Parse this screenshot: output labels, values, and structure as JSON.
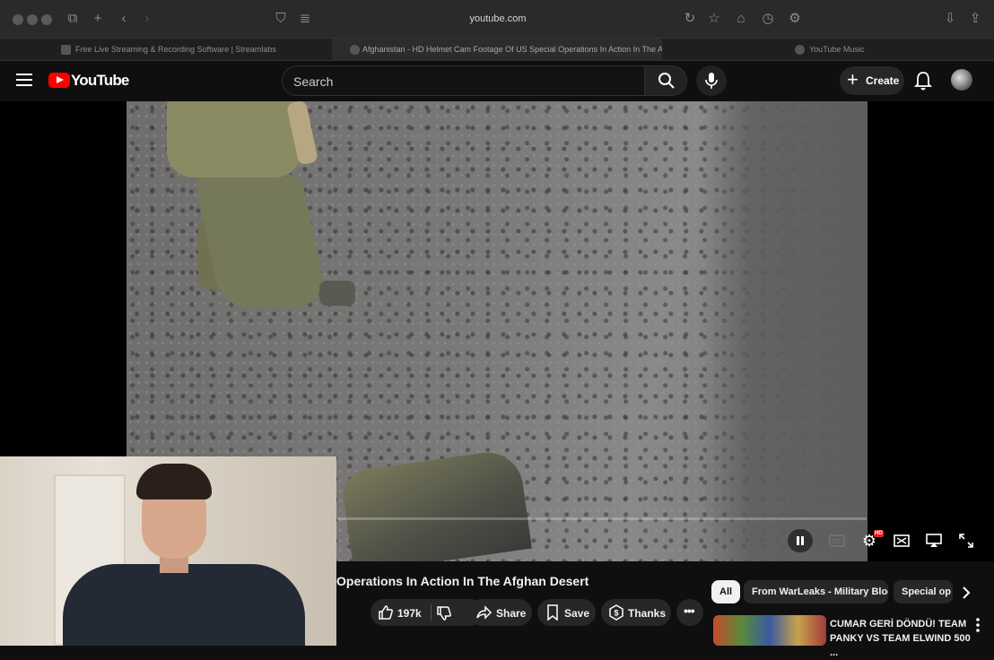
{
  "browser": {
    "url": "youtube.com",
    "tabs": [
      {
        "title": "Free Live Streaming & Recording Software | Streamlabs",
        "active": false
      },
      {
        "title": "Afghanistan - HD Helmet Cam Footage Of US Special Operations In Action In The Af...",
        "active": true
      },
      {
        "title": "YouTube Music",
        "active": false
      }
    ]
  },
  "header": {
    "logo_text": "YouTube",
    "search_placeholder": "Search",
    "create_label": "Create"
  },
  "video": {
    "title": "Operations In Action In The Afghan Desert",
    "hd_badge": "HD"
  },
  "actions": {
    "like_count": "197k",
    "share_label": "Share",
    "save_label": "Save",
    "thanks_label": "Thanks"
  },
  "chips": [
    {
      "label": "All",
      "selected": true
    },
    {
      "label": "From WarLeaks - Military Blog",
      "selected": false
    },
    {
      "label": "Special op",
      "selected": false
    }
  ],
  "recommendation": {
    "title": "CUMAR GERİ DÖNDÜ! TEAM PANKY VS TEAM ELWIND 500 ..."
  },
  "colors": {
    "brand_red": "#ff0000",
    "background": "#0f0f0f",
    "pill": "#272727"
  }
}
